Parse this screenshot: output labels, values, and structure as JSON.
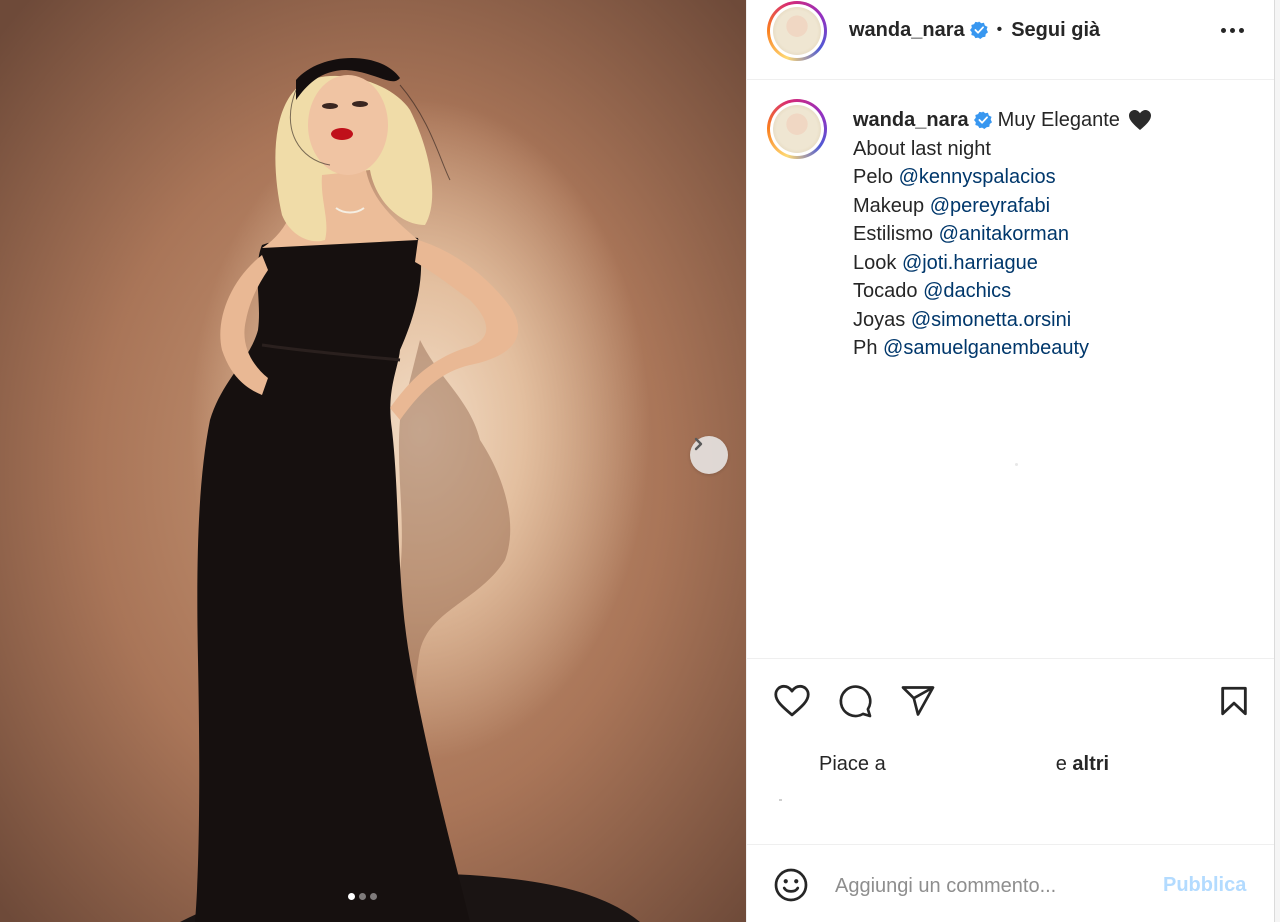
{
  "post": {
    "username": "wanda_nara",
    "separator": "•",
    "follow_status": "Segui già",
    "image_alt": "wanda_nara in a black strapless velvet gown",
    "carousel_dots": 3,
    "carousel_active": 0
  },
  "caption": {
    "username": "wanda_nara",
    "text": "Muy Elegante",
    "lines": [
      {
        "label": "About last night",
        "mention": ""
      },
      {
        "label": "Pelo ",
        "mention": "@kennyspalacios"
      },
      {
        "label": "Makeup ",
        "mention": "@pereyrafabi"
      },
      {
        "label": "Estilismo ",
        "mention": "@anitakorman"
      },
      {
        "label": "Look ",
        "mention": "@joti.harriague"
      },
      {
        "label": "Tocado ",
        "mention": "@dachics"
      },
      {
        "label": "Joyas ",
        "mention": "@simonetta.orsini"
      },
      {
        "label": "Ph ",
        "mention": "@samuelganembeauty"
      }
    ]
  },
  "likes": {
    "prefix": "Piace a",
    "connector": "e",
    "others": "altri"
  },
  "comment": {
    "placeholder": "Aggiungi un commento...",
    "publish_label": "Pubblica"
  },
  "icons": {
    "verified": "verified-badge-icon",
    "caption_emoji": "black-heart-icon",
    "like": "heart-icon",
    "comment": "comment-bubble-icon",
    "share": "paper-plane-icon",
    "save": "bookmark-icon",
    "more": "more-options-icon",
    "next": "chevron-right-icon",
    "emoji": "smiley-icon"
  },
  "colors": {
    "text": "#262626",
    "link": "#00376b",
    "verified": "#3897f0",
    "publish_disabled": "#b3dbff",
    "placeholder": "#8e8e8e"
  }
}
